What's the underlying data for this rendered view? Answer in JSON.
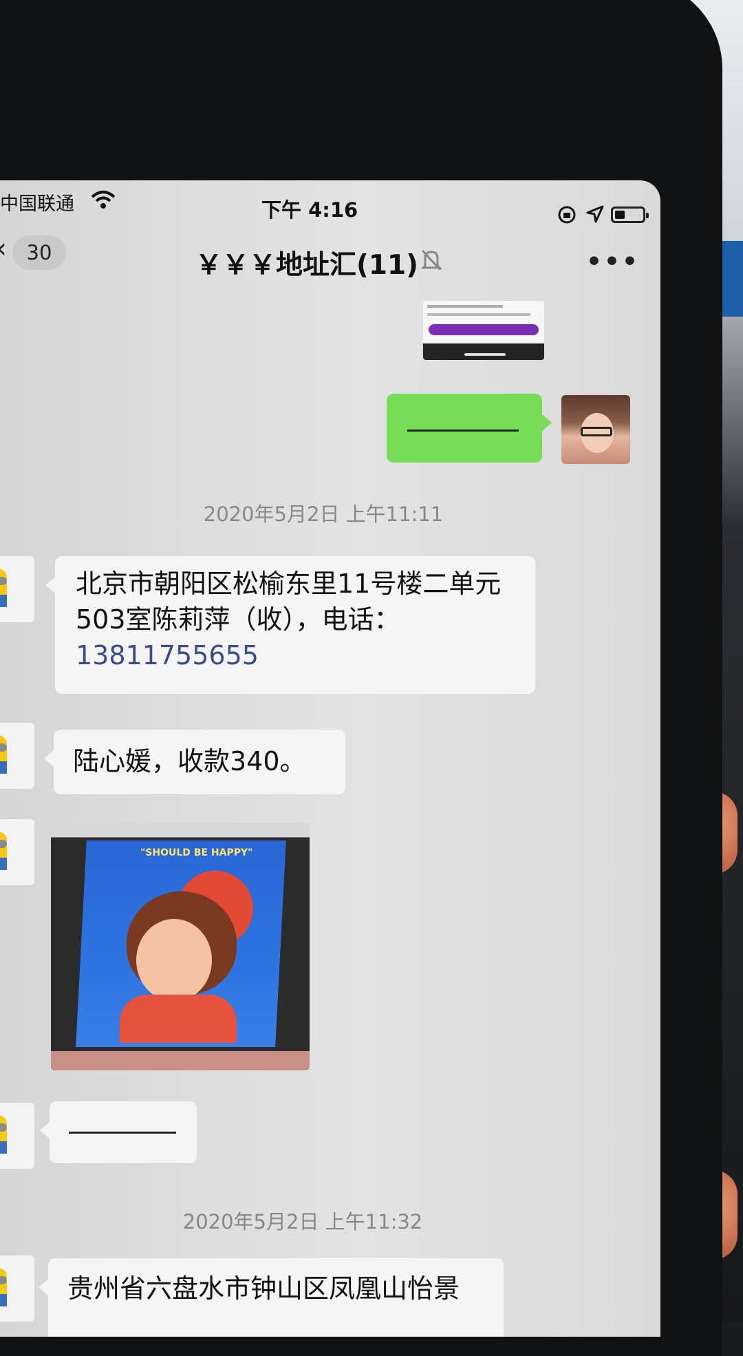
{
  "status_bar": {
    "carrier": "中国联通",
    "time": "下午 4:16"
  },
  "nav": {
    "unread_count": "30",
    "title": "￥￥￥地址汇(11)",
    "more": "•••"
  },
  "messages": {
    "timestamp_1": "2020年5月2日 上午11:11",
    "address_1_text": "北京市朝阳区松榆东里11号楼二单元503室陈莉萍（收），电话：",
    "address_1_phone": "13811755655",
    "payment_text": "陆心媛，收款340。",
    "photo_caption": "\"SHOULD BE HAPPY\"",
    "timestamp_2": "2020年5月2日 上午11:32",
    "address_2_text": "贵州省六盘水市钟山区凤凰山怡景"
  },
  "colors": {
    "self_bubble": "#77dc56",
    "other_bubble": "#f5f5f5",
    "phone_link": "#3a4c8a"
  },
  "icons": [
    "wifi-icon",
    "lock-rotation-icon",
    "location-arrow-icon",
    "battery-icon",
    "back-chevron-icon",
    "mute-bell-icon",
    "more-icon"
  ]
}
